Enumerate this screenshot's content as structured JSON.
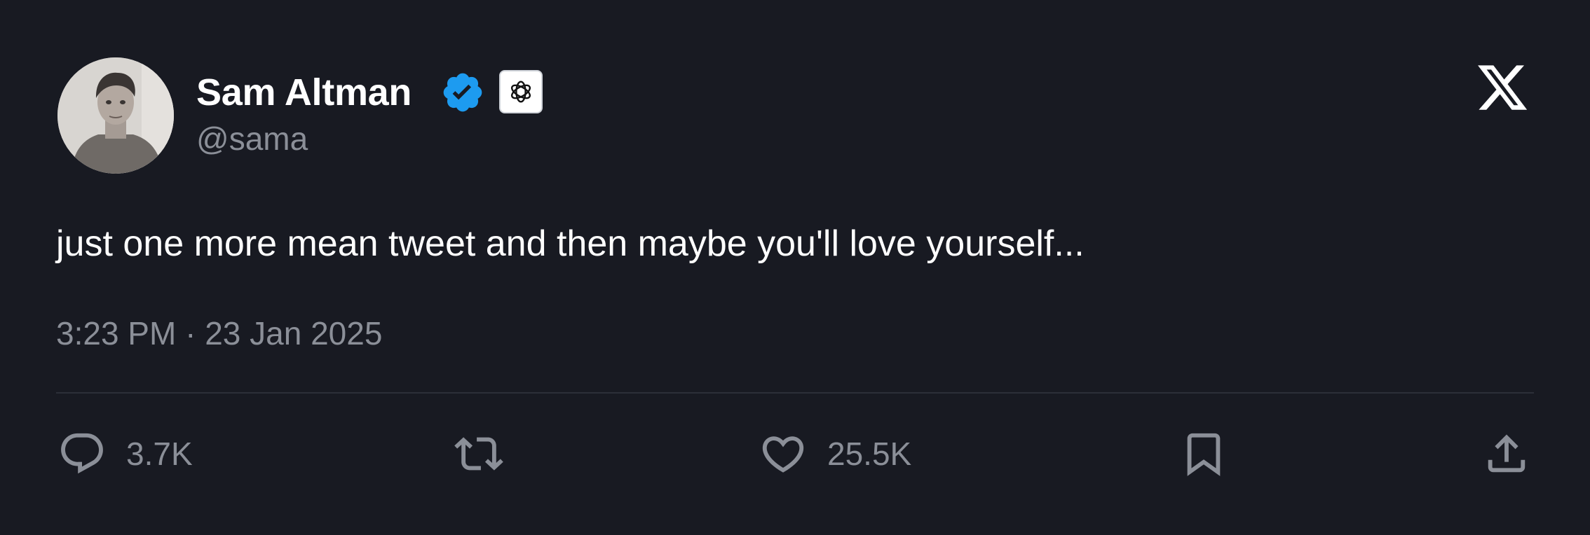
{
  "author": {
    "name": "Sam Altman",
    "handle": "@sama"
  },
  "tweet": {
    "text": "just one more mean tweet and then maybe you'll love yourself...",
    "timestamp": "3:23 PM · 23 Jan 2025"
  },
  "actions": {
    "replies": "3.7K",
    "likes": "25.5K"
  },
  "icons": {
    "verified": "verified-badge-icon",
    "affiliation": "openai-logo-icon",
    "brand": "x-logo-icon",
    "reply": "reply-icon",
    "retweet": "retweet-icon",
    "like": "heart-icon",
    "bookmark": "bookmark-icon",
    "share": "share-icon"
  },
  "colors": {
    "background": "#181a22",
    "verified": "#1d9bf0",
    "muted": "#8b8f98",
    "divider": "#2c2f38"
  }
}
